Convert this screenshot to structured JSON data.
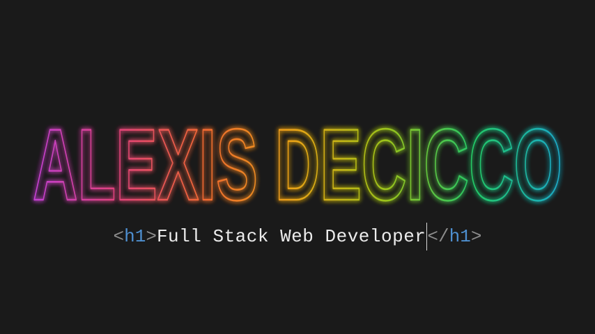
{
  "hero": {
    "name": "ALEXIS DECICCO",
    "gradient": [
      "#c03fd8",
      "#e0427a",
      "#f06a30",
      "#e8a515",
      "#9cc31a",
      "#22c868",
      "#1aa8cc"
    ]
  },
  "tagline": {
    "open_lt": "<",
    "open_tag": "h1",
    "open_gt": ">",
    "text": "Full Stack Web Developer",
    "close_lt": "</",
    "close_tag": "h1",
    "close_gt": ">"
  }
}
